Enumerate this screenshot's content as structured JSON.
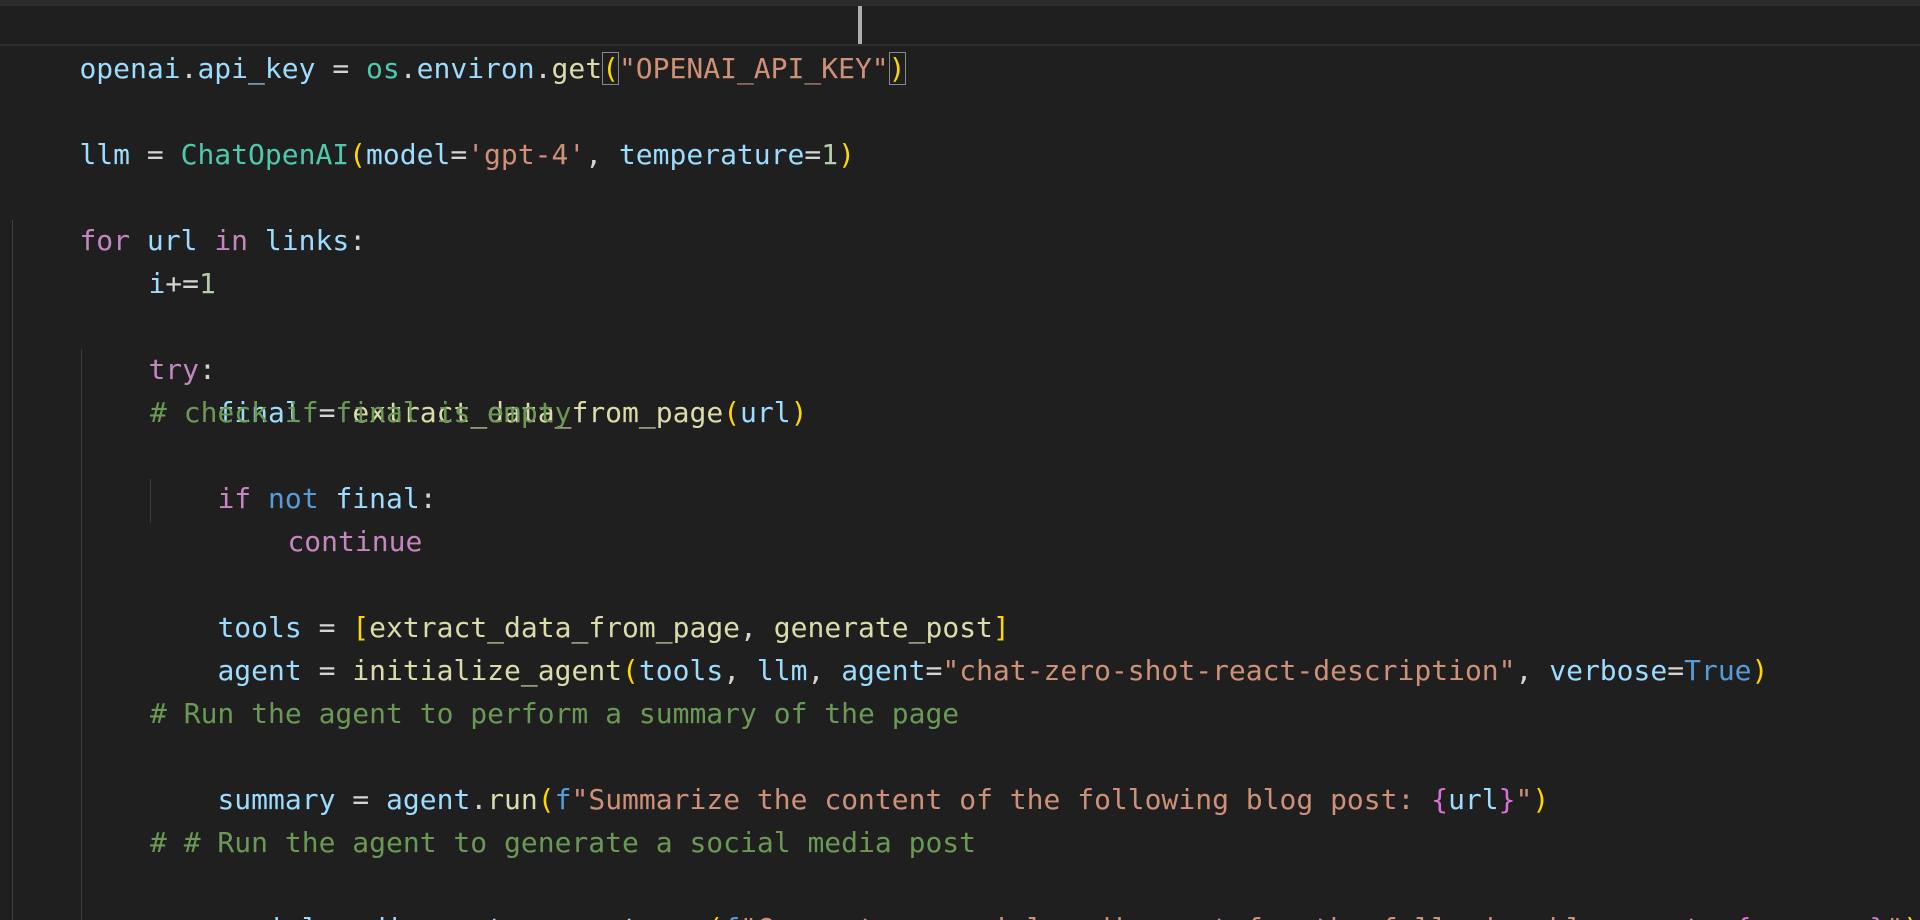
{
  "editor": {
    "language": "python",
    "cursor_line": 1
  },
  "code": {
    "l1": {
      "openai": "openai",
      "dot": ".",
      "api_key": "api_key",
      "eq": " = ",
      "os": "os",
      "dot2": ".",
      "environ": "environ",
      "dot3": ".",
      "get": "get",
      "lp": "(",
      "str": "\"OPENAI_API_KEY\"",
      "rp": ")"
    },
    "l3": {
      "llm": "llm",
      "eq": " = ",
      "cls": "ChatOpenAI",
      "lp": "(",
      "model": "model",
      "eq2": "=",
      "model_val": "'gpt-4'",
      "comma": ", ",
      "temperature": "temperature",
      "eq3": "=",
      "temp_val": "1",
      "rp": ")"
    },
    "l5": {
      "for": "for",
      "sp1": " ",
      "url": "url",
      "sp2": " ",
      "in": "in",
      "sp3": " ",
      "links": "links",
      "colon": ":"
    },
    "l6": {
      "i": "i",
      "op": "+=",
      "num": "1"
    },
    "l8": {
      "try": "try",
      "colon": ":"
    },
    "l9": {
      "final": "final",
      "eq": " = ",
      "fn": "extract_data_from_page",
      "lp": "(",
      "url": "url",
      "rp": ")"
    },
    "l10": {
      "comment": "# check if final is empty"
    },
    "l11": {
      "if": "if",
      "sp1": " ",
      "not": "not",
      "sp2": " ",
      "final": "final",
      "colon": ":"
    },
    "l12": {
      "continue": "continue"
    },
    "l14": {
      "tools": "tools",
      "eq": " = ",
      "lb": "[",
      "t1": "extract_data_from_page",
      "comma": ", ",
      "t2": "generate_post",
      "rb": "]"
    },
    "l15": {
      "agent": "agent",
      "eq": " = ",
      "fn": "initialize_agent",
      "lp": "(",
      "tools": "tools",
      "c1": ", ",
      "llm": "llm",
      "c2": ", ",
      "agent_kw": "agent",
      "eq2": "=",
      "agent_val": "\"chat-zero-shot-react-description\"",
      "c3": ", ",
      "verbose": "verbose",
      "eq3": "=",
      "true": "True",
      "rp": ")"
    },
    "l17": {
      "comment": "# Run the agent to perform a summary of the page"
    },
    "l18": {
      "summary": "summary",
      "eq": " = ",
      "agent": "agent",
      "dot": ".",
      "run": "run",
      "lp": "(",
      "f": "f",
      "s1": "\"Summarize the content of the following blog post: ",
      "lc": "{",
      "url": "url",
      "rc": "}",
      "s2": "\"",
      "rp": ")"
    },
    "l20": {
      "comment": "# # Run the agent to generate a social media post"
    },
    "l21": {
      "smp": "social_media_post",
      "eq": " = ",
      "agent": "agent",
      "dot": ".",
      "run": "run",
      "lp": "(",
      "f": "f",
      "s1": "\"Generate a social media post for the following blog post: ",
      "lc": "{",
      "summary": "summary",
      "rc": "}",
      "s2": "\"",
      "rp": ")"
    }
  }
}
